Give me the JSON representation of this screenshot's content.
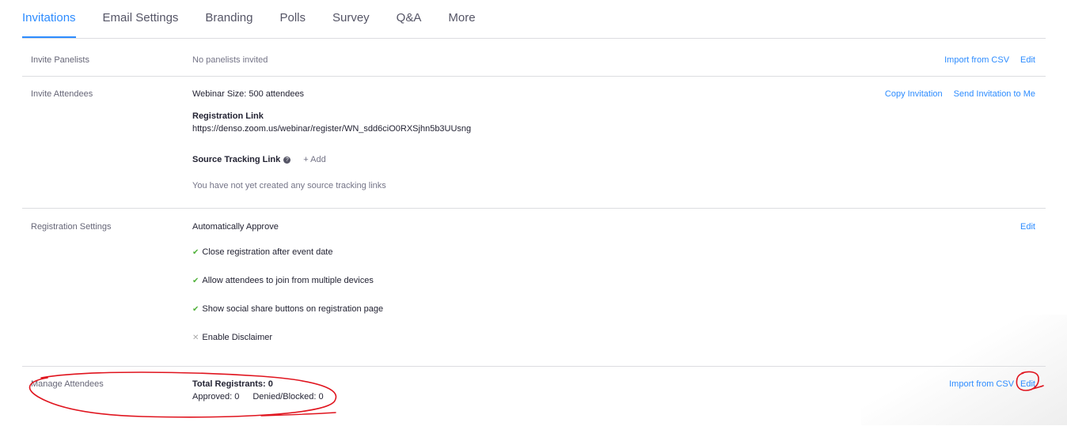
{
  "tabs": [
    "Invitations",
    "Email Settings",
    "Branding",
    "Polls",
    "Survey",
    "Q&A",
    "More"
  ],
  "invite_panelists": {
    "label": "Invite Panelists",
    "value": "No panelists invited",
    "action_import": "Import from CSV",
    "action_edit": "Edit"
  },
  "invite_attendees": {
    "label": "Invite Attendees",
    "webinar_size": "Webinar Size: 500 attendees",
    "registration_link_title": "Registration Link",
    "registration_link_url": "https://denso.zoom.us/webinar/register/WN_sdd6ciO0RXSjhn5b3UUsng",
    "source_tracking_title": "Source Tracking Link",
    "help_glyph": "?",
    "add_label": "+ Add",
    "source_tracking_empty": "You have not yet created any source tracking links",
    "action_copy": "Copy Invitation",
    "action_send": "Send Invitation to Me"
  },
  "registration_settings": {
    "label": "Registration Settings",
    "approval": "Automatically Approve",
    "options": [
      {
        "text": "Close registration after event date",
        "enabled": true
      },
      {
        "text": "Allow attendees to join from multiple devices",
        "enabled": true
      },
      {
        "text": "Show social share buttons on registration page",
        "enabled": true
      },
      {
        "text": "Enable Disclaimer",
        "enabled": false
      }
    ],
    "action_edit": "Edit"
  },
  "manage_attendees": {
    "label": "Manage Attendees",
    "total": "Total Registrants: 0",
    "approved": "Approved: 0",
    "denied": "Denied/Blocked: 0",
    "action_import": "Import from CSV",
    "action_edit": "Edit"
  },
  "colors": {
    "accent": "#2d8cff",
    "check": "#52b23c",
    "annotation": "#e0141e"
  },
  "icons": {
    "check": "check-icon",
    "cross": "cross-icon",
    "help": "help-icon"
  }
}
